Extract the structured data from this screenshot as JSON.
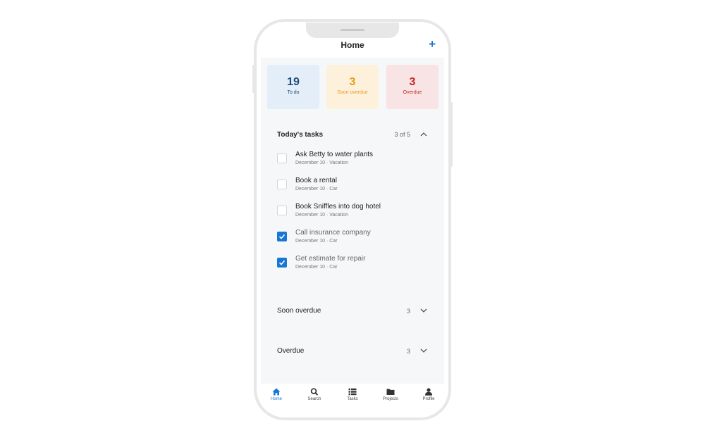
{
  "header": {
    "title": "Home",
    "add_label": "+"
  },
  "summary": [
    {
      "count": "19",
      "label": "To do"
    },
    {
      "count": "3",
      "label": "Soon overdue"
    },
    {
      "count": "3",
      "label": "Overdue"
    }
  ],
  "today": {
    "title": "Today's tasks",
    "progress": "3 of 5",
    "expanded": true,
    "tasks": [
      {
        "title": "Ask Betty to water plants",
        "meta": "December 10 · Vacation",
        "done": false
      },
      {
        "title": "Book a rental",
        "meta": "December 10 · Car",
        "done": false
      },
      {
        "title": "Book Sniffles into dog hotel",
        "meta": "December 10 · Vacation",
        "done": false
      },
      {
        "title": "Call insurance company",
        "meta": "December 10 · Car",
        "done": true
      },
      {
        "title": "Get estimate for repair",
        "meta": "December 10 · Car",
        "done": true
      }
    ]
  },
  "soon_overdue": {
    "title": "Soon overdue",
    "count": "3",
    "expanded": false
  },
  "overdue": {
    "title": "Overdue",
    "count": "3",
    "expanded": false
  },
  "tabs": [
    {
      "label": "Home",
      "icon": "home-icon",
      "active": true
    },
    {
      "label": "Search",
      "icon": "search-icon",
      "active": false
    },
    {
      "label": "Tasks",
      "icon": "list-icon",
      "active": false
    },
    {
      "label": "Projects",
      "icon": "folder-icon",
      "active": false
    },
    {
      "label": "Profile",
      "icon": "user-icon",
      "active": false
    }
  ],
  "colors": {
    "accent": "#1976d2",
    "todo": "#1d4e79",
    "soon_overdue": "#e89b1b",
    "overdue": "#c62828"
  }
}
